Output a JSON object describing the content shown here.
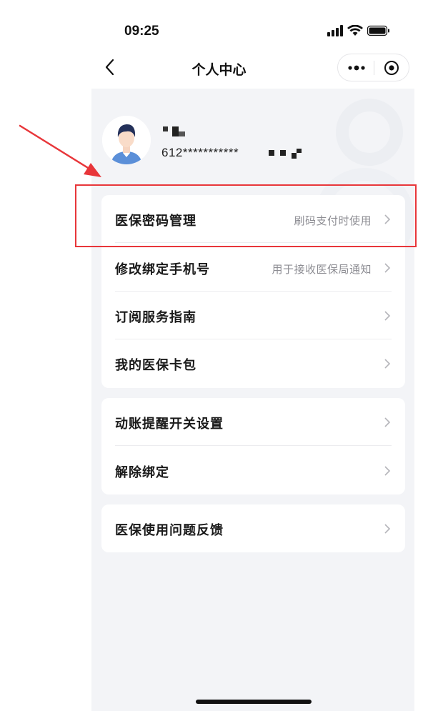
{
  "status_bar": {
    "time": "09:25"
  },
  "nav": {
    "title": "个人中心"
  },
  "profile": {
    "id_masked": "612***********"
  },
  "card1": [
    {
      "label": "医保密码管理",
      "hint": "刷码支付时使用"
    },
    {
      "label": "修改绑定手机号",
      "hint": "用于接收医保局通知"
    },
    {
      "label": "订阅服务指南",
      "hint": ""
    },
    {
      "label": "我的医保卡包",
      "hint": ""
    }
  ],
  "card2": [
    {
      "label": "动账提醒开关设置"
    },
    {
      "label": "解除绑定"
    }
  ],
  "card3": [
    {
      "label": "医保使用问题反馈"
    }
  ],
  "colors": {
    "highlight": "#e8363a",
    "background": "#f3f4f7",
    "card": "#ffffff"
  },
  "icons": [
    "back-icon",
    "more-icon",
    "close-target-icon",
    "signal-icon",
    "wifi-icon",
    "battery-icon",
    "chevron-right-icon"
  ]
}
